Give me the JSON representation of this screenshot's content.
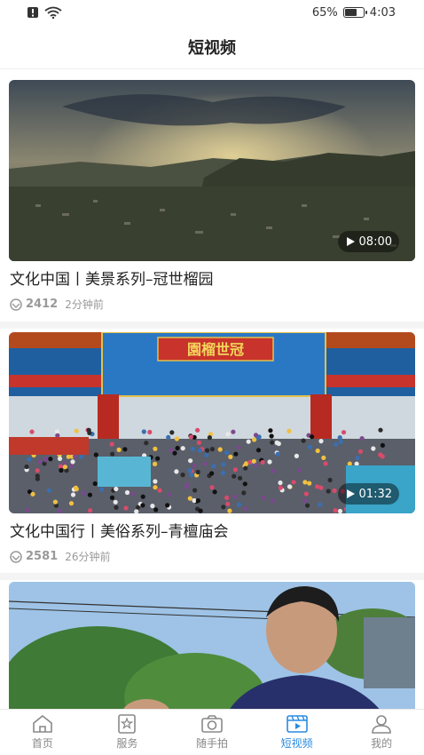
{
  "status_bar": {
    "battery_text": "65%",
    "battery_level": 0.65,
    "time": "4:03"
  },
  "header": {
    "title": "短视频"
  },
  "videos": [
    {
      "title": "文化中国丨美景系列–冠世榴园",
      "views": "2412",
      "time_ago": "2分钟前",
      "duration": "08:00"
    },
    {
      "title": "文化中国行丨美俗系列–青檀庙会",
      "views": "2581",
      "time_ago": "26分钟前",
      "duration": "01:32",
      "gate_sign": "園榴世冠"
    },
    {
      "title": "",
      "views": "",
      "time_ago": "",
      "duration": ""
    }
  ],
  "tabbar": {
    "items": [
      {
        "label": "首页",
        "icon": "home-icon"
      },
      {
        "label": "服务",
        "icon": "service-icon"
      },
      {
        "label": "随手拍",
        "icon": "camera-icon"
      },
      {
        "label": "短视频",
        "icon": "video-icon",
        "active": true
      },
      {
        "label": "我的",
        "icon": "user-icon"
      }
    ],
    "active_color": "#2a8be0"
  }
}
